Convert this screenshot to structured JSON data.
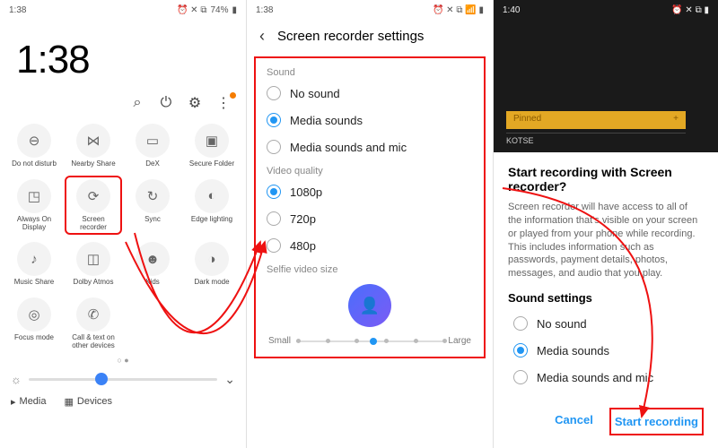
{
  "panel1": {
    "status": {
      "time": "1:38",
      "battery": "74%",
      "icons": "⏰ ✕ ⧉"
    },
    "clock": "1:38",
    "toolbar": {
      "search": "search",
      "power": "power",
      "settings": "settings",
      "more": "more"
    },
    "tiles": [
      {
        "icon": "⊖",
        "label": "Do not disturb"
      },
      {
        "icon": "⋈",
        "label": "Nearby Share"
      },
      {
        "icon": "▭",
        "label": "DeX"
      },
      {
        "icon": "▣",
        "label": "Secure Folder"
      },
      {
        "icon": "◳",
        "label": "Always On Display"
      },
      {
        "icon": "⟳",
        "label": "Screen recorder",
        "hl": true
      },
      {
        "icon": "↻",
        "label": "Sync"
      },
      {
        "icon": "◐",
        "label": "Edge lighting"
      },
      {
        "icon": "♪",
        "label": "Music Share"
      },
      {
        "icon": "◫",
        "label": "Dolby Atmos"
      },
      {
        "icon": "☻",
        "label": "Kids"
      },
      {
        "icon": "◑",
        "label": "Dark mode"
      },
      {
        "icon": "◎",
        "label": "Focus mode"
      },
      {
        "icon": "✆",
        "label": "Call & text on other devices"
      }
    ],
    "brightness": 35,
    "footer": {
      "media": "Media",
      "devices": "Devices"
    }
  },
  "panel2": {
    "status": {
      "time": "1:38",
      "icons": "⏰ ✕ ⧉ 📶 ▮"
    },
    "title": "Screen recorder settings",
    "sections": {
      "sound": {
        "h": "Sound",
        "opts": [
          "No sound",
          "Media sounds",
          "Media sounds and mic"
        ],
        "sel": 1
      },
      "quality": {
        "h": "Video quality",
        "opts": [
          "1080p",
          "720p",
          "480p"
        ],
        "sel": 0
      },
      "selfie": {
        "h": "Selfie video size",
        "small": "Small",
        "large": "Large",
        "val": 50
      }
    }
  },
  "panel3": {
    "status": {
      "time": "1:40",
      "icons": "⏰ ✕ ⧉ ▮"
    },
    "pinned": "Pinned",
    "kotse": "KOTSE",
    "dialog": {
      "title": "Start recording with Screen recorder?",
      "text": "Screen recorder will have access to all of the information that's visible on your screen or played from your phone while recording. This includes information such as passwords, payment details, photos, messages, and audio that you play.",
      "sub": "Sound settings",
      "opts": [
        "No sound",
        "Media sounds",
        "Media sounds and mic"
      ],
      "sel": 1,
      "cancel": "Cancel",
      "start": "Start recording"
    }
  }
}
